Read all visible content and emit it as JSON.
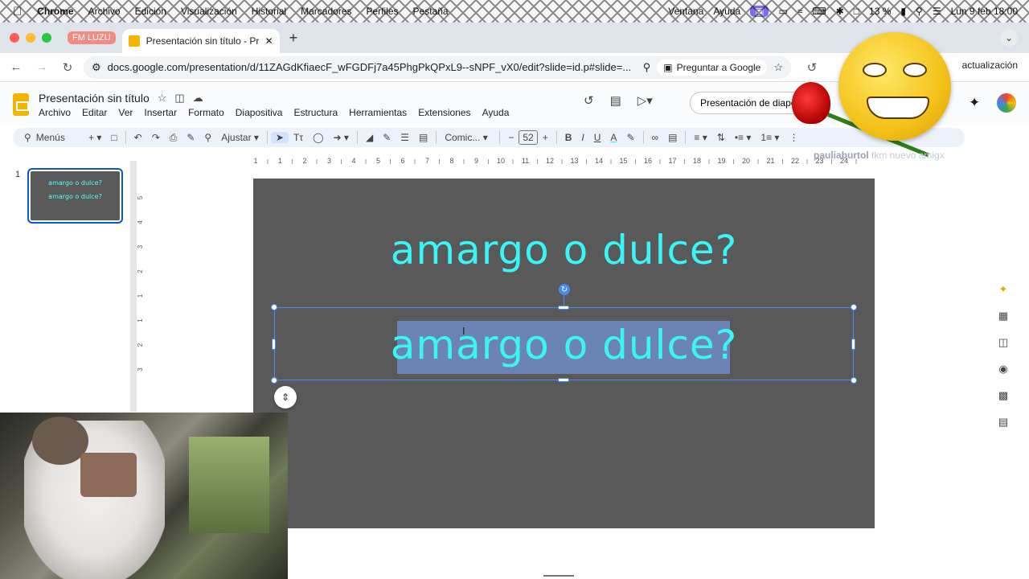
{
  "menubar": {
    "app": "Chrome",
    "items": [
      "Archivo",
      "Edición",
      "Visualización",
      "Historial",
      "Marcadores",
      "Perfiles",
      "Pestaña"
    ],
    "right_items": [
      "Ventana",
      "Ayuda"
    ],
    "battery": "13 %",
    "clock": "Lun 9 feb 18:00"
  },
  "browser": {
    "profile_chip": "FM LUZU",
    "tab_title": "Presentación sin título - Prese",
    "url": "docs.google.com/presentation/d/11ZAGdKfiaecF_wFGDFj7a45PhgPkQPxL9--sNPF_vX0/edit?slide=id.p#slide=...",
    "ask_google": "Preguntar a Google",
    "update_label": "actualización"
  },
  "doc": {
    "title": "Presentación sin título",
    "menu": [
      "Archivo",
      "Editar",
      "Ver",
      "Insertar",
      "Formato",
      "Diapositiva",
      "Estructura",
      "Herramientas",
      "Extensiones",
      "Ayuda"
    ],
    "present_button": "Presentación de diapositivas"
  },
  "toolbar": {
    "search": "Menús",
    "zoom": "Ajustar",
    "font": "Comic...",
    "font_size": "52"
  },
  "slides": {
    "number": "1",
    "thumb_line1": "amargo o dulce?",
    "thumb_line2": "amargo o dulce?"
  },
  "slide": {
    "title_text": "amargo o dulce?",
    "body_text": "amargo o dulce?",
    "background": "#595959",
    "text_color": "#39f5f5"
  },
  "ruler": {
    "top": [
      "1",
      "1",
      "2",
      "3",
      "4",
      "5",
      "6",
      "7",
      "8",
      "9",
      "10",
      "11",
      "12",
      "13",
      "14",
      "15",
      "16",
      "17",
      "18",
      "19",
      "20",
      "21",
      "22",
      "23",
      "24"
    ],
    "left": [
      "5",
      "4",
      "3",
      "2",
      "1",
      "1",
      "2",
      "3"
    ]
  },
  "watermark": {
    "user": "pauliaburtol",
    "caption": "tkm nuevo amigx"
  }
}
